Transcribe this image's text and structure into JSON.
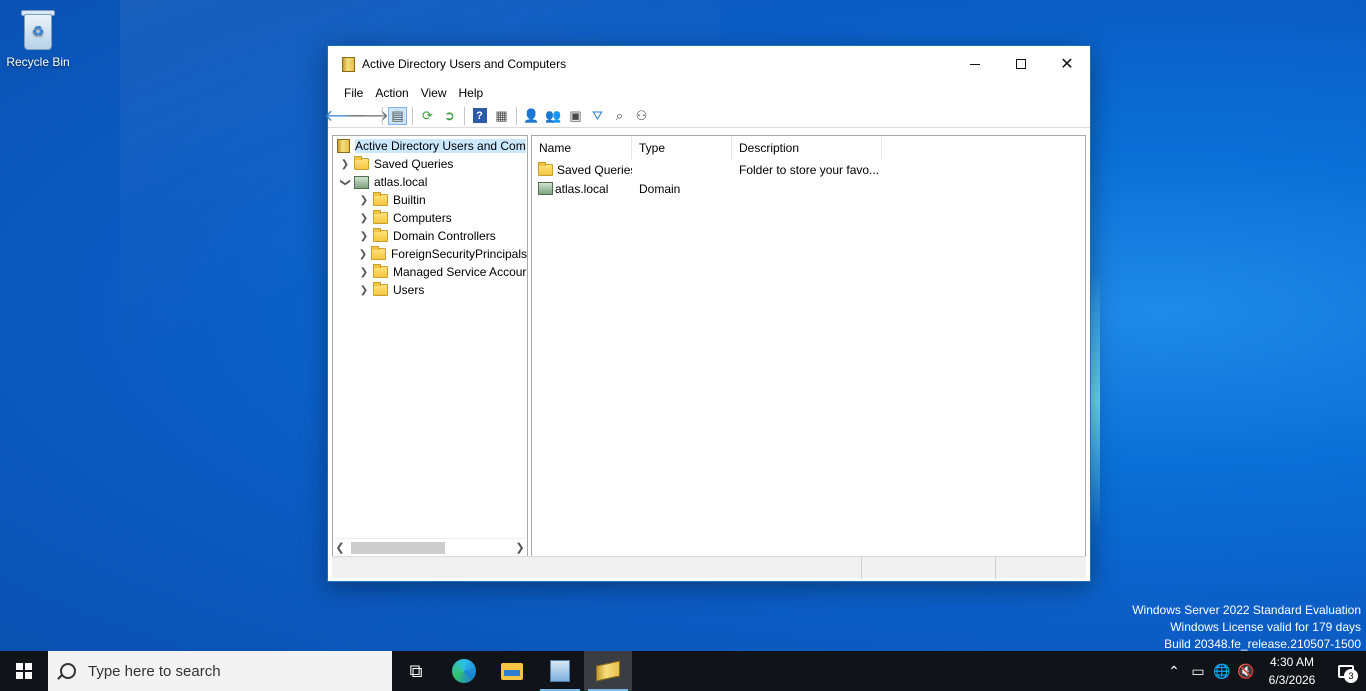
{
  "desktop": {
    "icons": [
      {
        "label": "Recycle Bin",
        "icon": "recycle-bin-icon"
      }
    ],
    "watermark": [
      "Windows Server 2022 Standard Evaluation",
      "Windows License valid for 179 days",
      "Build 20348.fe_release.210507-1500"
    ]
  },
  "window": {
    "title": "Active Directory Users and Computers",
    "controls": {
      "minimize": "minimize",
      "maximize": "maximize",
      "close": "✕"
    },
    "menu": [
      "File",
      "Action",
      "View",
      "Help"
    ],
    "toolbar": [
      "back-arrow-icon",
      "forward-arrow-icon",
      "show-hide-console-tree-icon",
      "refresh-icon",
      "export-list-icon",
      "help-icon",
      "properties-icon",
      "new-user-icon",
      "new-group-icon",
      "new-ou-icon",
      "filter-icon",
      "find-icon",
      "add-to-group-icon"
    ]
  },
  "tree": {
    "root": "Active Directory Users and Com",
    "items": [
      {
        "label": "Saved Queries",
        "level": 1,
        "expanded": false,
        "icon": "folder-icon"
      },
      {
        "label": "atlas.local",
        "level": 1,
        "expanded": true,
        "icon": "domain-icon"
      },
      {
        "label": "Builtin",
        "level": 2,
        "expanded": false,
        "icon": "folder-icon"
      },
      {
        "label": "Computers",
        "level": 2,
        "expanded": false,
        "icon": "folder-icon"
      },
      {
        "label": "Domain Controllers",
        "level": 2,
        "expanded": false,
        "icon": "ou-folder-icon"
      },
      {
        "label": "ForeignSecurityPrincipals",
        "level": 2,
        "expanded": false,
        "icon": "folder-icon"
      },
      {
        "label": "Managed Service Accour",
        "level": 2,
        "expanded": false,
        "icon": "folder-icon"
      },
      {
        "label": "Users",
        "level": 2,
        "expanded": false,
        "icon": "folder-icon"
      }
    ]
  },
  "list": {
    "columns": [
      "Name",
      "Type",
      "Description"
    ],
    "rows": [
      {
        "name": "Saved Queries",
        "type": "",
        "description": "Folder to store your favo...",
        "icon": "folder-icon"
      },
      {
        "name": "atlas.local",
        "type": "Domain",
        "description": "",
        "icon": "domain-icon"
      }
    ]
  },
  "taskbar": {
    "search_placeholder": "Type here to search",
    "apps": [
      "task-view-icon",
      "edge-icon",
      "file-explorer-icon",
      "server-manager-icon",
      "aduc-icon"
    ],
    "tray": {
      "time": "4:30 AM",
      "date": "6/3/2026",
      "notifications": "3"
    }
  },
  "colors": {
    "accent": "#0b5cc4",
    "selection": "#cce8ff",
    "taskbar": "#101418"
  }
}
